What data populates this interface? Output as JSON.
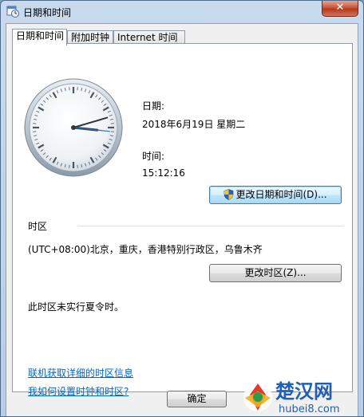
{
  "window": {
    "title": "日期和时间",
    "close_glyph": "✕"
  },
  "tabs": [
    {
      "label": "日期和时间"
    },
    {
      "label": "附加时钟"
    },
    {
      "label": "Internet 时间"
    }
  ],
  "datetime": {
    "date_label": "日期:",
    "date_value": "2018年6月19日 星期二",
    "time_label": "时间:",
    "time_value": "15:12:16",
    "change_button": "更改日期和时间(D)..."
  },
  "timezone": {
    "section_label": "时区",
    "value": "(UTC+08:00)北京，重庆，香港特别行政区，乌鲁木齐",
    "change_button": "更改时区(Z)...",
    "dst_note": "此时区未实行夏令时。"
  },
  "links": {
    "online_info": "联机获取详细的时区信息",
    "how_to": "我如何设置时钟和时区?"
  },
  "footer": {
    "ok_label": "确定"
  },
  "watermark": {
    "brand": "楚汉网",
    "site": "hubei8.com"
  },
  "colors": {
    "link": "#0066cc",
    "accent": "#3c7fb1"
  }
}
